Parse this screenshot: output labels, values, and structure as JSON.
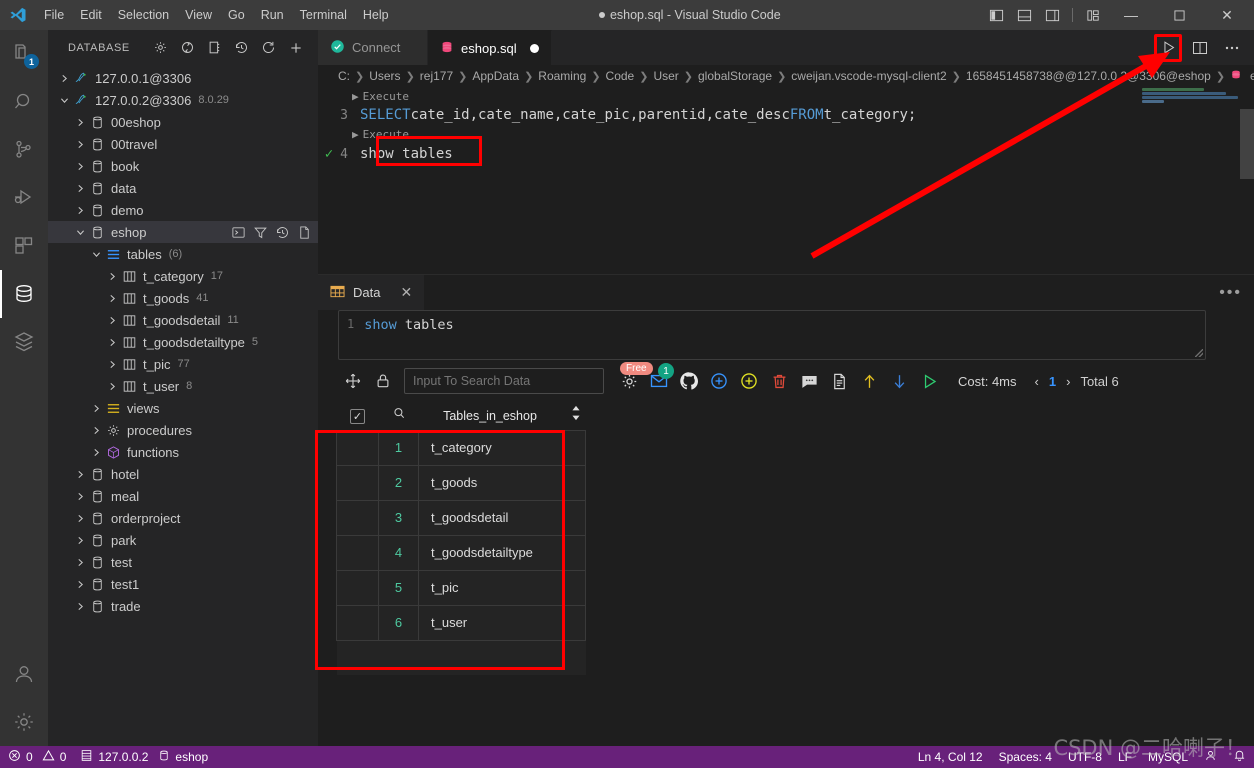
{
  "titlebar": {
    "menus": [
      "File",
      "Edit",
      "Selection",
      "View",
      "Go",
      "Run",
      "Terminal",
      "Help"
    ],
    "window_title": "eshop.sql - Visual Studio Code",
    "minimize": "—",
    "maximize": "☐",
    "close": "✕"
  },
  "activitybar": {
    "items": [
      {
        "name": "explorer",
        "icon": "files-icon",
        "badge": "1"
      },
      {
        "name": "search",
        "icon": "search-icon",
        "badge": ""
      },
      {
        "name": "source-control",
        "icon": "source-control-icon",
        "badge": ""
      },
      {
        "name": "run-debug",
        "icon": "run-debug-icon",
        "badge": ""
      },
      {
        "name": "extensions",
        "icon": "extensions-icon",
        "badge": ""
      },
      {
        "name": "database",
        "icon": "database-icon",
        "badge": ""
      },
      {
        "name": "layers",
        "icon": "layers-icon",
        "badge": ""
      }
    ],
    "bottom": [
      {
        "name": "accounts",
        "icon": "account-icon"
      },
      {
        "name": "settings",
        "icon": "gear-icon"
      }
    ]
  },
  "sidebar": {
    "title": "DATABASE",
    "actions": [
      "gear-icon",
      "refresh-circle-icon",
      "server-icon",
      "history-icon",
      "reload-icon",
      "plus-icon"
    ],
    "tree": [
      {
        "indent": 0,
        "twisty": "right",
        "icon": "mysql-icon",
        "label": "127.0.0.1@3306",
        "count": ""
      },
      {
        "indent": 0,
        "twisty": "down",
        "icon": "mysql-icon",
        "label": "127.0.0.2@3306",
        "count": "8.0.29"
      },
      {
        "indent": 1,
        "twisty": "right",
        "icon": "db-icon",
        "label": "00eshop",
        "count": ""
      },
      {
        "indent": 1,
        "twisty": "right",
        "icon": "db-icon",
        "label": "00travel",
        "count": ""
      },
      {
        "indent": 1,
        "twisty": "right",
        "icon": "db-icon",
        "label": "book",
        "count": ""
      },
      {
        "indent": 1,
        "twisty": "right",
        "icon": "db-icon",
        "label": "data",
        "count": ""
      },
      {
        "indent": 1,
        "twisty": "right",
        "icon": "db-icon",
        "label": "demo",
        "count": ""
      },
      {
        "indent": 1,
        "twisty": "down",
        "icon": "db-icon",
        "label": "eshop",
        "count": "",
        "selected": true,
        "actions": [
          "terminal-icon",
          "filter-icon",
          "history-icon",
          "new-file-icon"
        ]
      },
      {
        "indent": 2,
        "twisty": "down",
        "icon": "tables-icon",
        "label": "tables",
        "count": "(6)"
      },
      {
        "indent": 3,
        "twisty": "right",
        "icon": "table-icon",
        "label": "t_category",
        "count": "17"
      },
      {
        "indent": 3,
        "twisty": "right",
        "icon": "table-icon",
        "label": "t_goods",
        "count": "41"
      },
      {
        "indent": 3,
        "twisty": "right",
        "icon": "table-icon",
        "label": "t_goodsdetail",
        "count": "11"
      },
      {
        "indent": 3,
        "twisty": "right",
        "icon": "table-icon",
        "label": "t_goodsdetailtype",
        "count": "5"
      },
      {
        "indent": 3,
        "twisty": "right",
        "icon": "table-icon",
        "label": "t_pic",
        "count": "77"
      },
      {
        "indent": 3,
        "twisty": "right",
        "icon": "table-icon",
        "label": "t_user",
        "count": "8"
      },
      {
        "indent": 2,
        "twisty": "right",
        "icon": "views-icon",
        "label": "views",
        "count": ""
      },
      {
        "indent": 2,
        "twisty": "right",
        "icon": "procedures-icon",
        "label": "procedures",
        "count": ""
      },
      {
        "indent": 2,
        "twisty": "right",
        "icon": "functions-icon",
        "label": "functions",
        "count": ""
      },
      {
        "indent": 1,
        "twisty": "right",
        "icon": "db-icon",
        "label": "hotel",
        "count": ""
      },
      {
        "indent": 1,
        "twisty": "right",
        "icon": "db-icon",
        "label": "meal",
        "count": ""
      },
      {
        "indent": 1,
        "twisty": "right",
        "icon": "db-icon",
        "label": "orderproject",
        "count": ""
      },
      {
        "indent": 1,
        "twisty": "right",
        "icon": "db-icon",
        "label": "park",
        "count": ""
      },
      {
        "indent": 1,
        "twisty": "right",
        "icon": "db-icon",
        "label": "test",
        "count": ""
      },
      {
        "indent": 1,
        "twisty": "right",
        "icon": "db-icon",
        "label": "test1",
        "count": ""
      },
      {
        "indent": 1,
        "twisty": "right",
        "icon": "db-icon",
        "label": "trade",
        "count": ""
      }
    ]
  },
  "editor": {
    "tabs": [
      {
        "label": "Connect",
        "icon": "check-circle-icon",
        "active": false,
        "dirty": false
      },
      {
        "label": "eshop.sql",
        "icon": "mysql-file-icon",
        "active": true,
        "dirty": true
      }
    ],
    "actions": [
      "run-icon",
      "split-editor-icon",
      "more-actions-icon"
    ],
    "breadcrumb": [
      "C:",
      "Users",
      "rej177",
      "AppData",
      "Roaming",
      "Code",
      "User",
      "globalStorage",
      "cweijan.vscode-mysql-client2",
      "1658451458738@@127.0.0.2@3306@eshop",
      "eshop.sql"
    ],
    "code": {
      "codelens_1": "Execute",
      "line3_num": "3",
      "line3_keyword1": "SELECT",
      "line3_cols": " cate_id,cate_name,cate_pic,parentid,cate_desc ",
      "line3_keyword2": "FROM",
      "line3_table": " t_category;",
      "codelens_2": "Execute",
      "line4_num": "4",
      "line4_text": "show tables"
    }
  },
  "panel": {
    "tab_label": "Data",
    "tab_icon": "table-grid-icon",
    "close_icon": "✕",
    "more_icon": "•••",
    "sql_line_num": "1",
    "sql_keyword": "show",
    "sql_rest": " tables",
    "toolbar": {
      "move_icon": "move-icon",
      "lock_icon": "lock-icon",
      "search_placeholder": "Input To Search Data",
      "search_value": "",
      "gear_icon": "gear-icon",
      "free_badge": "Free",
      "mail_icon": "mail-icon",
      "mail_badge": "1",
      "github_icon": "github-icon",
      "add_icon": "plus-circle-icon",
      "add_row_icon": "plus-circle-yellow-icon",
      "delete_icon": "trash-icon",
      "comment_icon": "comment-icon",
      "export_icon": "export-file-icon",
      "import_icon": "arrow-up-icon",
      "download_icon": "arrow-down-icon",
      "run_icon": "run-triangle-icon",
      "cost": "Cost: 4ms",
      "prev_icon": "‹",
      "page": "1",
      "next_icon": "›",
      "total": "Total 6"
    },
    "table": {
      "header_check": "✓",
      "header_search_icon": "search-icon",
      "column": "Tables_in_eshop",
      "sort_icon": "sort-icon",
      "rows": [
        {
          "num": "1",
          "value": "t_category"
        },
        {
          "num": "2",
          "value": "t_goods"
        },
        {
          "num": "3",
          "value": "t_goodsdetail"
        },
        {
          "num": "4",
          "value": "t_goodsdetailtype"
        },
        {
          "num": "5",
          "value": "t_pic"
        },
        {
          "num": "6",
          "value": "t_user"
        }
      ]
    }
  },
  "statusbar": {
    "errors": "0",
    "warnings": "0",
    "host": "127.0.0.2",
    "database": "eshop",
    "position": "Ln 4, Col 12",
    "spaces": "Spaces: 4",
    "encoding": "UTF-8",
    "eol": "LF",
    "language": "MySQL",
    "bell_icon": "bell-icon",
    "person_icon": "person-icon"
  },
  "watermark": "CSDN @二哈喇子！",
  "colors": {
    "accent": "#68217a",
    "highlight_red": "#ff0000",
    "keyword_blue": "#569cd6",
    "green_check": "#3fb950"
  }
}
